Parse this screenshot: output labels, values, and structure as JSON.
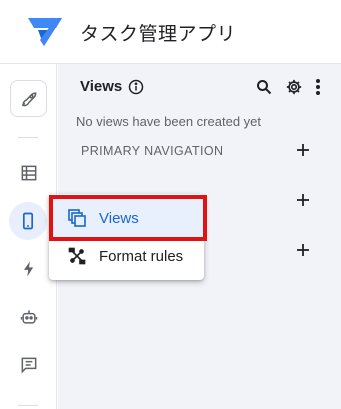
{
  "app": {
    "title": "タスク管理アプリ",
    "logo_icon": "appsheet-logo-icon"
  },
  "rail": {
    "items": [
      {
        "name": "rocket-icon"
      },
      {
        "name": "table-icon"
      },
      {
        "name": "phone-icon",
        "active": true
      },
      {
        "name": "bolt-icon"
      },
      {
        "name": "robot-icon"
      },
      {
        "name": "comment-icon"
      }
    ]
  },
  "panel": {
    "title": "Views",
    "empty_message": "No views have been created yet",
    "primary_nav_label": "PRIMARY NAVIGATION"
  },
  "menu": {
    "items": [
      {
        "label": "Views",
        "icon": "views-icon",
        "selected": true
      },
      {
        "label": "Format rules",
        "icon": "format-rules-icon",
        "selected": false
      }
    ]
  },
  "colors": {
    "accent": "#1a66d2",
    "selected_bg": "#e8f0fe",
    "highlight": "#e01212",
    "panel_bg": "#f1f3f8"
  }
}
